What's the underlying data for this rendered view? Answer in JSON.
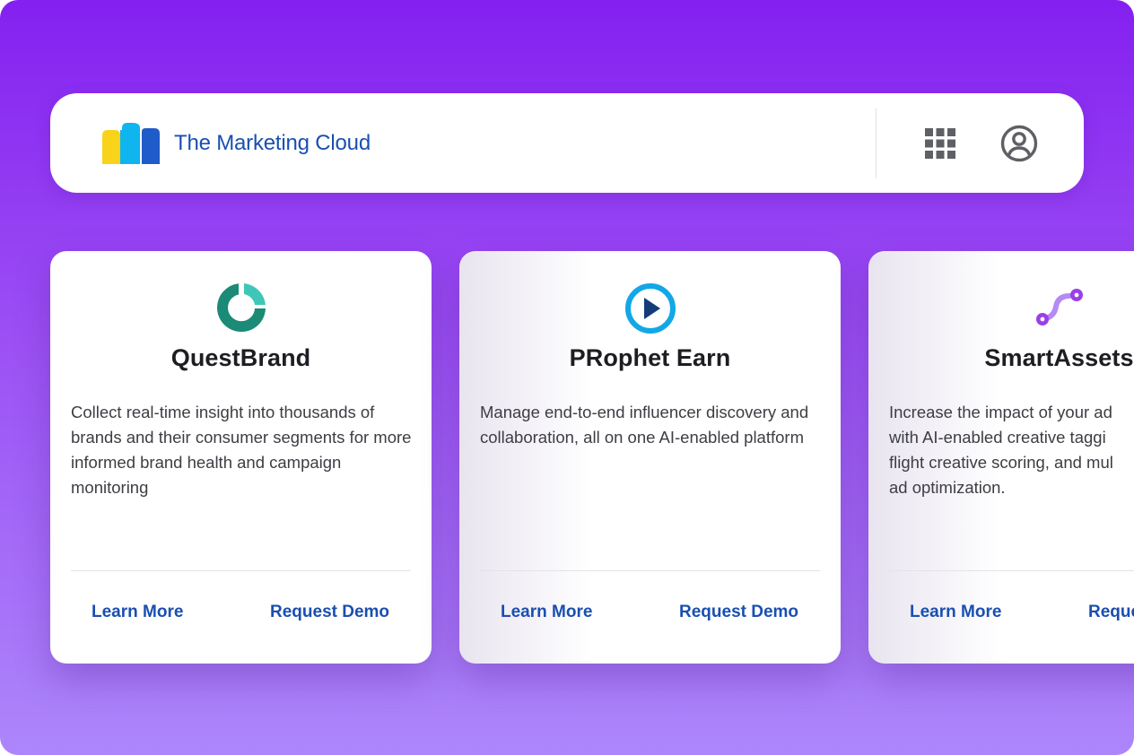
{
  "header": {
    "brand_name": "The Marketing Cloud",
    "apps_icon": "grid-apps-icon",
    "account_icon": "user-circle-icon"
  },
  "colors": {
    "background_top": "#8420f0",
    "background_bottom": "#ad86fb",
    "link_blue": "#1a4fb0",
    "logo_yellow": "#f9d21a",
    "logo_cyan": "#0fb5ee",
    "logo_blue": "#1f5bc9"
  },
  "products": [
    {
      "icon": "questbrand-ring-icon",
      "title": "QuestBrand",
      "description": "Collect real-time insight into thousands of brands and their consumer segments for more informed brand health and campaign monitoring",
      "learn_more": "Learn More",
      "request_demo": "Request Demo"
    },
    {
      "icon": "play-circle-icon",
      "title": "PRophet Earn",
      "description": "Manage end-to-end influencer discovery and collaboration, all on one AI-enabled platform",
      "learn_more": "Learn More",
      "request_demo": "Request Demo"
    },
    {
      "icon": "connected-nodes-icon",
      "title": "SmartAssets",
      "description_lines": [
        "Increase the impact of your ad",
        "with AI-enabled creative taggi",
        "flight creative scoring, and mul",
        "ad optimization."
      ],
      "learn_more": "Learn More",
      "request_demo": "Reque"
    }
  ]
}
